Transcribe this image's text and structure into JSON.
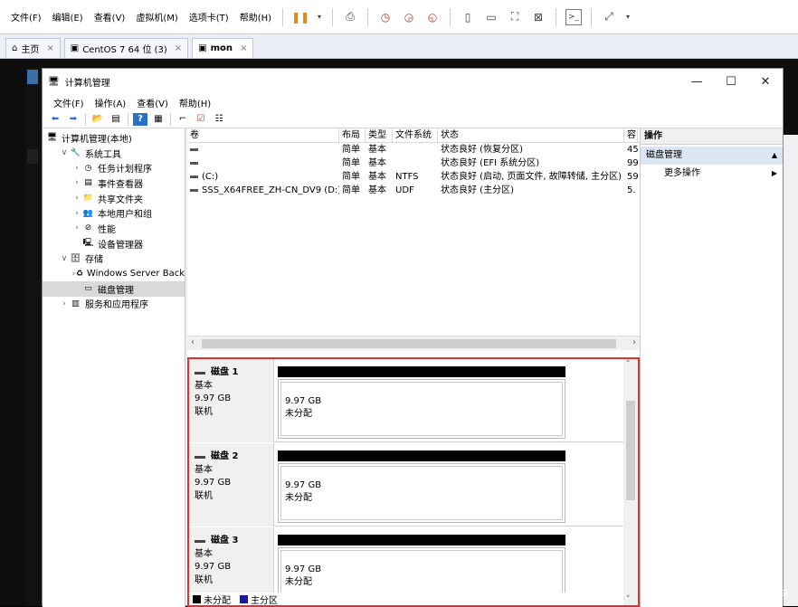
{
  "vm_menu": [
    "文件(F)",
    "编辑(E)",
    "查看(V)",
    "虚拟机(M)",
    "选项卡(T)",
    "帮助(H)"
  ],
  "vm_tabs": [
    {
      "label": "主页",
      "active": false
    },
    {
      "label": "CentOS 7 64 位 (3)",
      "active": false
    },
    {
      "label": "mon",
      "active": true
    }
  ],
  "window": {
    "title": "计算机管理",
    "menu": [
      "文件(F)",
      "操作(A)",
      "查看(V)",
      "帮助(H)"
    ]
  },
  "tree": [
    {
      "label": "计算机管理(本地)",
      "arrow": "",
      "indent": 0,
      "icon": "computer-management-icon",
      "glyph": "🖥",
      "selected": false
    },
    {
      "label": "系统工具",
      "arrow": "v",
      "indent": 1,
      "icon": "system-tools-icon",
      "glyph": "🔧",
      "selected": false
    },
    {
      "label": "任务计划程序",
      "arrow": ">",
      "indent": 2,
      "icon": "task-scheduler-icon",
      "glyph": "◷",
      "selected": false
    },
    {
      "label": "事件查看器",
      "arrow": ">",
      "indent": 2,
      "icon": "event-viewer-icon",
      "glyph": "▤",
      "selected": false
    },
    {
      "label": "共享文件夹",
      "arrow": ">",
      "indent": 2,
      "icon": "shared-folders-icon",
      "glyph": "📁",
      "selected": false
    },
    {
      "label": "本地用户和组",
      "arrow": ">",
      "indent": 2,
      "icon": "local-users-icon",
      "glyph": "👥",
      "selected": false
    },
    {
      "label": "性能",
      "arrow": ">",
      "indent": 2,
      "icon": "performance-icon",
      "glyph": "⊘",
      "selected": false
    },
    {
      "label": "设备管理器",
      "arrow": "",
      "indent": 2,
      "icon": "device-manager-icon",
      "glyph": "🖳",
      "selected": false
    },
    {
      "label": "存储",
      "arrow": "v",
      "indent": 1,
      "icon": "storage-icon",
      "glyph": "🗄",
      "selected": false
    },
    {
      "label": "Windows Server Back",
      "arrow": ">",
      "indent": 2,
      "icon": "server-backup-icon",
      "glyph": "♻",
      "selected": false
    },
    {
      "label": "磁盘管理",
      "arrow": "",
      "indent": 2,
      "icon": "disk-management-icon",
      "glyph": "▭",
      "selected": true
    },
    {
      "label": "服务和应用程序",
      "arrow": ">",
      "indent": 1,
      "icon": "services-apps-icon",
      "glyph": "▥",
      "selected": false
    }
  ],
  "volume_columns": [
    "卷",
    "布局",
    "类型",
    "文件系统",
    "状态",
    "容"
  ],
  "volumes": [
    {
      "vol": "",
      "layout": "简单",
      "type": "基本",
      "fs": "",
      "status": "状态良好 (恢复分区)",
      "cap": "45"
    },
    {
      "vol": "",
      "layout": "简单",
      "type": "基本",
      "fs": "",
      "status": "状态良好 (EFI 系统分区)",
      "cap": "99"
    },
    {
      "vol": "(C:)",
      "layout": "简单",
      "type": "基本",
      "fs": "NTFS",
      "status": "状态良好 (启动, 页面文件, 故障转储, 主分区)",
      "cap": "59"
    },
    {
      "vol": "SSS_X64FREE_ZH-CN_DV9 (D:)",
      "layout": "简单",
      "type": "基本",
      "fs": "UDF",
      "status": "状态良好 (主分区)",
      "cap": "5."
    }
  ],
  "disks": [
    {
      "name": "磁盘 1",
      "kind": "基本",
      "size": "9.97 GB",
      "state": "联机",
      "part_size": "9.97 GB",
      "part_label": "未分配"
    },
    {
      "name": "磁盘 2",
      "kind": "基本",
      "size": "9.97 GB",
      "state": "联机",
      "part_size": "9.97 GB",
      "part_label": "未分配"
    },
    {
      "name": "磁盘 3",
      "kind": "基本",
      "size": "9.97 GB",
      "state": "联机",
      "part_size": "9.97 GB",
      "part_label": "未分配"
    }
  ],
  "legend": [
    {
      "label": "未分配",
      "color": "#000000"
    },
    {
      "label": "主分区",
      "color": "#1a1aa0"
    }
  ],
  "actions": {
    "header": "操作",
    "section": "磁盘管理",
    "item": "更多操作"
  },
  "watermark": "CSDN @云夏之末",
  "highlight_color": "#e0302f"
}
